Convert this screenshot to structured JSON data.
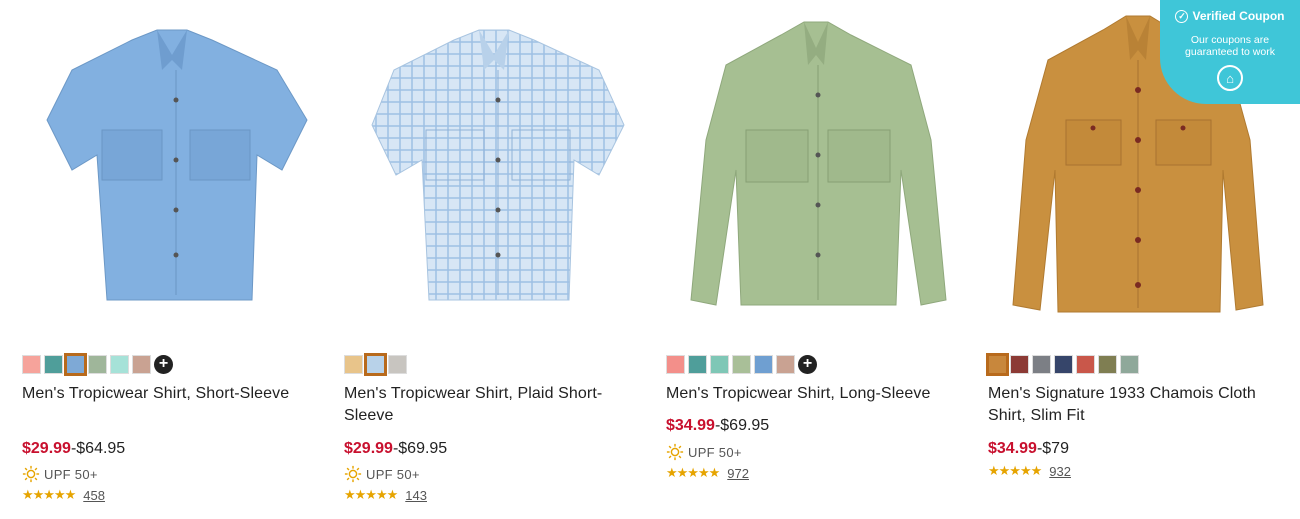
{
  "products": [
    {
      "title": "Men's Tropicwear Shirt, Short-Sleeve",
      "sale_price": "$29.99",
      "reg_price": "-$64.95",
      "upf": "UPF 50+",
      "rating_count": "458",
      "stars": "★★★★★",
      "swatches": [
        "#f6a39b",
        "#4f9e9a",
        "#7ea9d6",
        "#9fb69a",
        "#a6e2d8",
        "#c9a292"
      ],
      "selected_swatch": 2,
      "has_more": true
    },
    {
      "title": "Men's Tropicwear Shirt, Plaid Short-Sleeve",
      "sale_price": "$29.99",
      "reg_price": "-$69.95",
      "upf": "UPF 50+",
      "rating_count": "143",
      "stars": "★★★★★",
      "swatches": [
        "#e8c48a",
        "#b8d2e9",
        "#c8c5c0"
      ],
      "selected_swatch": 1,
      "has_more": false
    },
    {
      "title": "Men's Tropicwear Shirt, Long-Sleeve",
      "sale_price": "$34.99",
      "reg_price": "-$69.95",
      "upf": "UPF 50+",
      "rating_count": "972",
      "stars": "★★★★★",
      "swatches": [
        "#f38f8a",
        "#4f9e9a",
        "#7fc7b6",
        "#a9bf98",
        "#6f9fd1",
        "#c9a292"
      ],
      "selected_swatch": -1,
      "has_more": true
    },
    {
      "title": "Men's Signature 1933 Chamois Cloth Shirt, Slim Fit",
      "sale_price": "$34.99",
      "reg_price": "-$79",
      "upf": "",
      "rating_count": "932",
      "stars": "★★★★★",
      "swatches": [
        "#c8873c",
        "#8c3a35",
        "#7c7f85",
        "#36456a",
        "#c9574a",
        "#7f7e52",
        "#8fa89a"
      ],
      "selected_swatch": 0,
      "has_more": false
    }
  ],
  "coupon": {
    "title": "Verified Coupon",
    "subtitle": "Our coupons are guaranteed to work",
    "accent": "#3fc6d8"
  },
  "colors": {
    "sale": "#c8102e",
    "star": "#e6a400"
  },
  "icons": {
    "more": "plus-icon",
    "upf": "sun-icon",
    "verified": "check-circle-icon"
  }
}
